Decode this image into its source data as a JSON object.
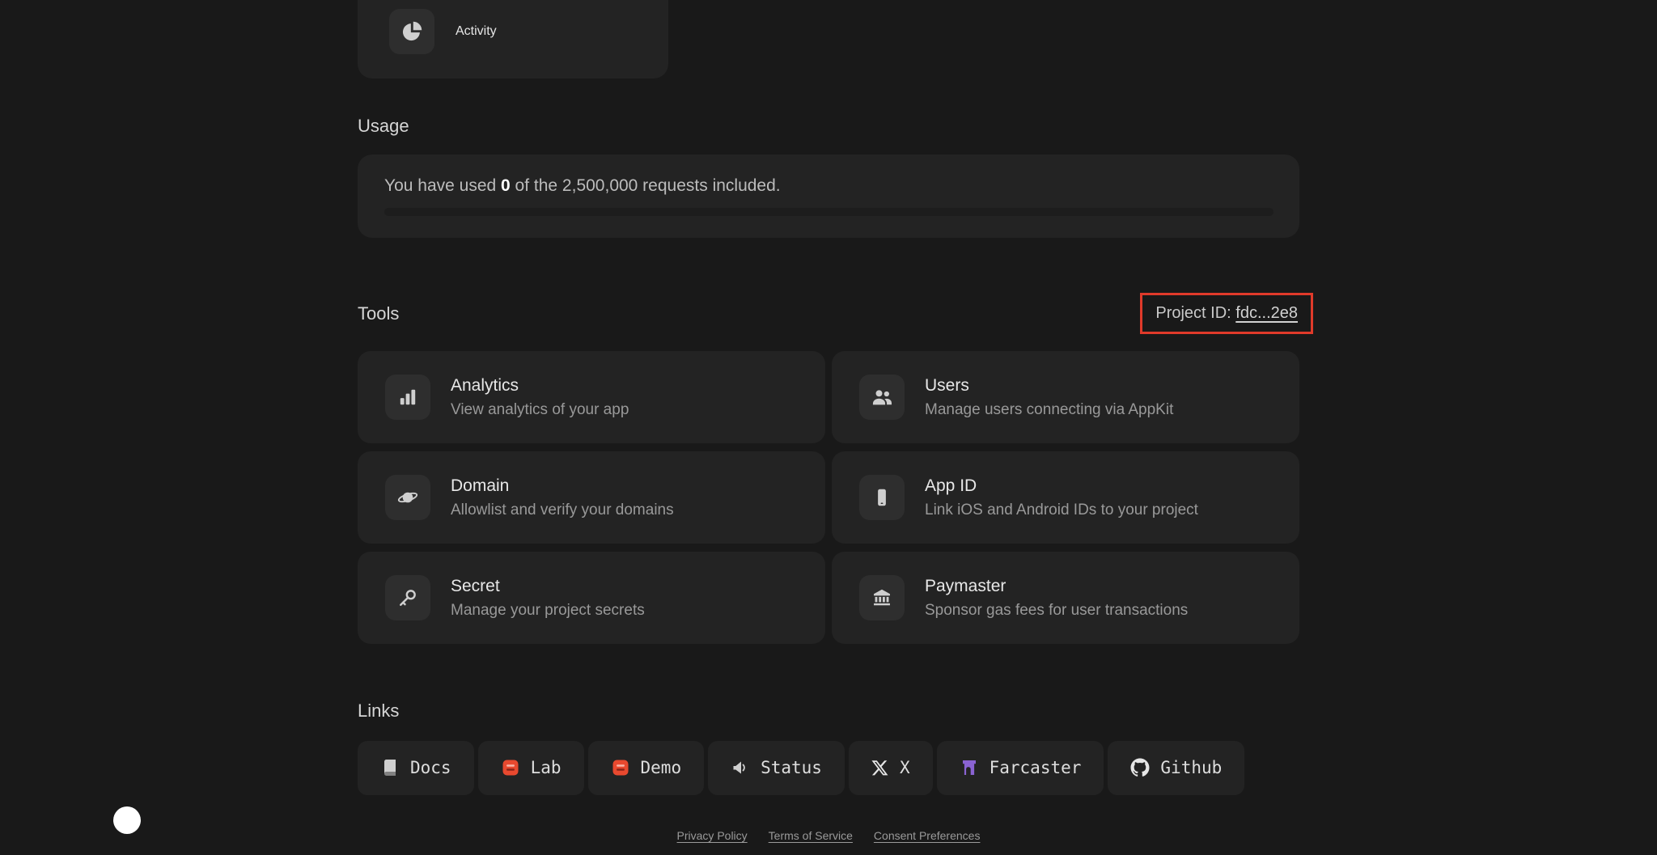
{
  "activity": {
    "label": "Activity",
    "icon": "pie-chart-icon"
  },
  "usage": {
    "heading": "Usage",
    "prefix": "You have used ",
    "used_value": "0",
    "suffix": " of the 2,500,000 requests included.",
    "progress_percent": 0
  },
  "tools": {
    "heading": "Tools",
    "project_id_label": "Project ID: ",
    "project_id_value": "fdc...2e8",
    "highlight_color": "#e03a2a",
    "cards": [
      {
        "title": "Analytics",
        "description": "View analytics of your app",
        "icon": "bar-chart-icon"
      },
      {
        "title": "Users",
        "description": "Manage users connecting via AppKit",
        "icon": "users-icon"
      },
      {
        "title": "Domain",
        "description": "Allowlist and verify your domains",
        "icon": "planet-icon"
      },
      {
        "title": "App ID",
        "description": "Link iOS and Android IDs to your project",
        "icon": "mobile-phone-icon"
      },
      {
        "title": "Secret",
        "description": "Manage your project secrets",
        "icon": "key-icon"
      },
      {
        "title": "Paymaster",
        "description": "Sponsor gas fees for user transactions",
        "icon": "bank-icon"
      }
    ]
  },
  "links": {
    "heading": "Links",
    "items": [
      {
        "label": "Docs",
        "icon": "docs-book-icon"
      },
      {
        "label": "Lab",
        "icon": "lab-app-icon",
        "icon_color": "#e8492f"
      },
      {
        "label": "Demo",
        "icon": "demo-app-icon",
        "icon_color": "#e8492f"
      },
      {
        "label": "Status",
        "icon": "megaphone-icon"
      },
      {
        "label": "X",
        "icon": "x-logo-icon"
      },
      {
        "label": "Farcaster",
        "icon": "farcaster-icon",
        "icon_color": "#8a63d2"
      },
      {
        "label": "Github",
        "icon": "github-icon"
      }
    ]
  },
  "footer": {
    "links": [
      {
        "label": "Privacy Policy"
      },
      {
        "label": "Terms of Service"
      },
      {
        "label": "Consent Preferences"
      }
    ]
  }
}
